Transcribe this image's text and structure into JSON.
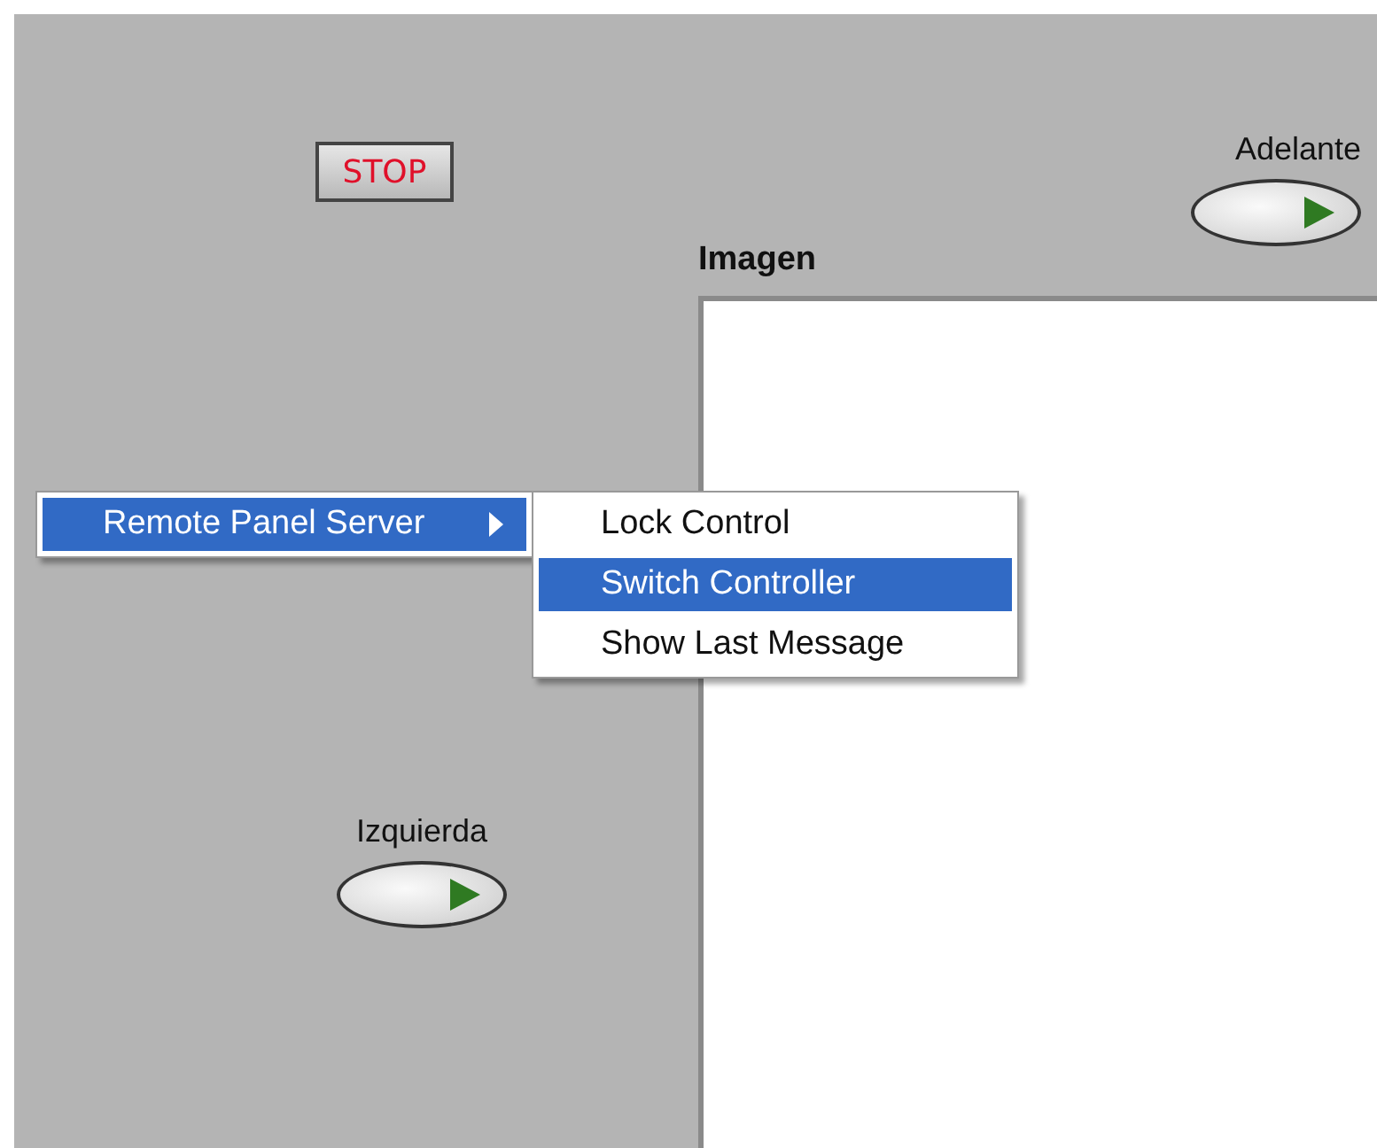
{
  "stop_button": {
    "label": "STOP"
  },
  "switches": [
    {
      "label": "Adelante",
      "on": false
    },
    {
      "label": "Izquierda",
      "on": false
    }
  ],
  "image_display": {
    "label": "Imagen"
  },
  "context_menu": {
    "items": [
      {
        "label": "Remote Panel Server",
        "selected": true,
        "has_submenu": true
      }
    ]
  },
  "submenu": {
    "items": [
      {
        "label": "Lock Control",
        "selected": false
      },
      {
        "label": "Switch Controller",
        "selected": true
      },
      {
        "label": "Show Last Message",
        "selected": false
      }
    ]
  }
}
